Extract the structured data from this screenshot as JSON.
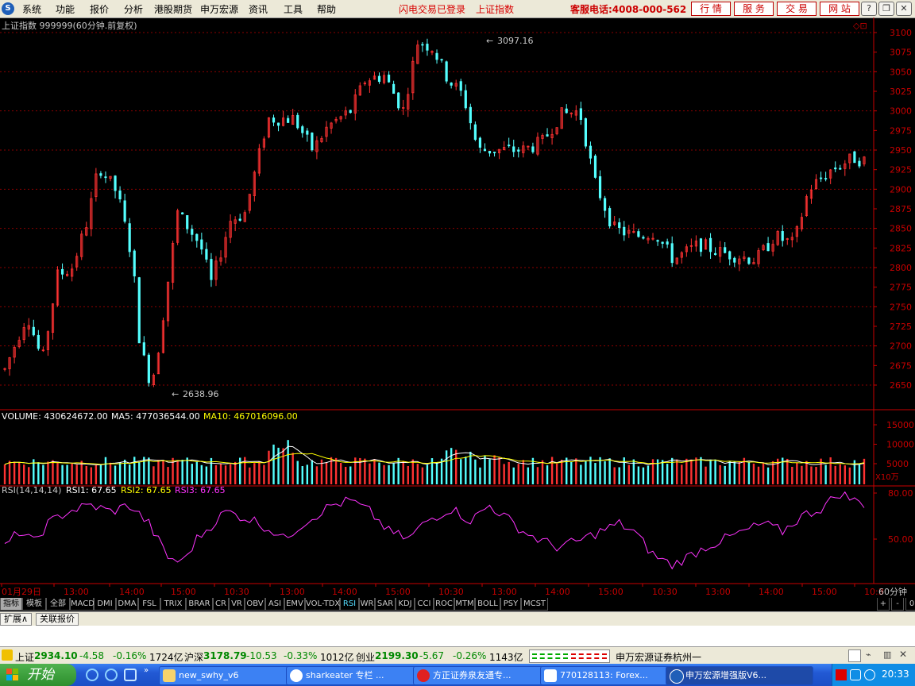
{
  "menu": {
    "items": [
      "系统",
      "功能",
      "报价",
      "分析",
      "港股期货",
      "申万宏源",
      "资讯",
      "工具",
      "帮助"
    ],
    "flash_login": "闪电交易已登录",
    "index_name": "上证指数",
    "hotline": "客服电话:4008-000-562",
    "buttons": [
      "行 情",
      "服 务",
      "交 易",
      "网 站"
    ]
  },
  "main_chart": {
    "title": "上证指数 999999(60分钟.前复权)",
    "high_label": "3097.16",
    "low_label": "2638.96",
    "y_ticks": [
      "3100",
      "3075",
      "3050",
      "3025",
      "3000",
      "2975",
      "2950",
      "2925",
      "2900",
      "2875",
      "2850",
      "2825",
      "2800",
      "2775",
      "2750",
      "2725",
      "2700",
      "2675",
      "2650"
    ]
  },
  "volume_panel": {
    "vol_label": "VOLUME: 430624672.00",
    "ma5_label": "MA5: 477036544.00",
    "ma10_label": "MA10: 467016096.00",
    "y_ticks": [
      "15000",
      "10000",
      "5000"
    ],
    "unit": "X10万"
  },
  "rsi_panel": {
    "label": "RSI(14,14,14)",
    "rsi1": "RSI1: 67.65",
    "rsi2": "RSI2: 67.65",
    "rsi3": "RSI3: 67.65",
    "y_ticks": [
      "80.00",
      "50.00"
    ]
  },
  "time_axis": {
    "labels": [
      "01月29日",
      "13:00",
      "14:00",
      "15:00",
      "10:30",
      "13:00",
      "14:00",
      "15:00",
      "10:30",
      "13:00",
      "14:00",
      "15:00",
      "10:30",
      "13:00",
      "14:00",
      "15:00",
      "10:3"
    ],
    "period": "60分钟"
  },
  "indicator_tabs": [
    "指标",
    "模板",
    "全部",
    "MACD",
    "DMI",
    "DMA",
    "FSL",
    "TRIX",
    "BRAR",
    "CR",
    "VR",
    "OBV",
    "ASI",
    "EMV",
    "VOL-TDX",
    "RSI",
    "WR",
    "SAR",
    "KDJ",
    "CCI",
    "ROC",
    "MTM",
    "BOLL",
    "PSY",
    "MCST"
  ],
  "active_tab": "RSI",
  "tab_controls": [
    "+",
    "-",
    "0"
  ],
  "expand_bar": [
    "扩展∧",
    "关联报价"
  ],
  "status": {
    "sh_name": "上证",
    "sh_value": "2934.10",
    "sh_change": "-4.58",
    "sh_pct": "-0.16%",
    "sh_amount": "1724亿",
    "hs_name": "沪深",
    "hs_value": "3178.79",
    "hs_change": "-10.53",
    "hs_pct": "-0.33%",
    "hs_amount": "1012亿",
    "cy_name": "创业",
    "cy_value": "2199.30",
    "cy_change": "-5.67",
    "cy_pct": "-0.26%",
    "cy_amount": "1143亿",
    "broker": "申万宏源证券杭州一"
  },
  "taskbar": {
    "start": "开始",
    "tasks": [
      "new_swhy_v6",
      "sharkeater 专栏 ...",
      "方正证券泉友通专...",
      "770128113: Forex...",
      "申万宏源增强版V6..."
    ],
    "clock": "20:33"
  },
  "colors": {
    "up": "#ff3232",
    "down": "#54ffff",
    "grid": "#8b0000",
    "axis": "#c80000",
    "vol_label": "#ffffff",
    "ma10": "#ffff00",
    "rsi": "#ff33ff"
  }
}
